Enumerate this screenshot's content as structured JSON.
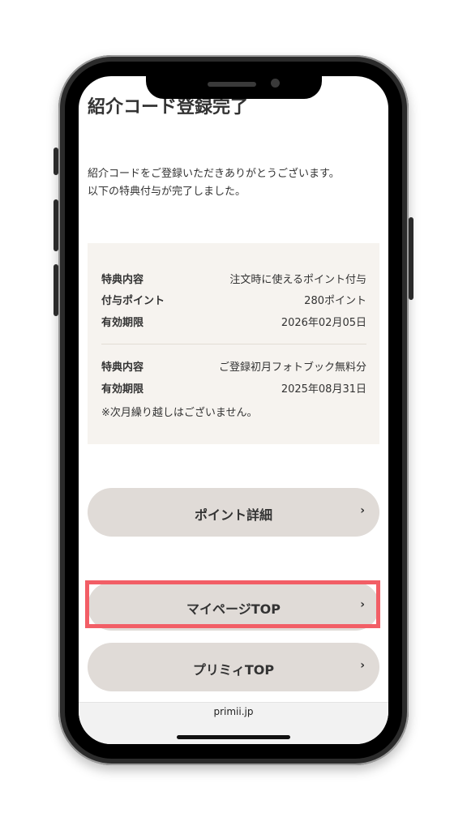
{
  "page": {
    "title": "紹介コード登録完了",
    "message_lines": [
      "紹介コードをご登録いただきありがとうございます。",
      "以下の特典付与が完了しました。"
    ]
  },
  "benefits": {
    "group1": {
      "content_label": "特典内容",
      "content_value": "注文時に使えるポイント付与",
      "points_label": "付与ポイント",
      "points_value": "280ポイント",
      "expiry_label": "有効期限",
      "expiry_value": "2026年02月05日"
    },
    "group2": {
      "content_label": "特典内容",
      "content_value": "ご登録初月フォトブック無料分",
      "expiry_label": "有効期限",
      "expiry_value": "2025年08月31日",
      "note": "※次月繰り越しはございません。"
    }
  },
  "buttons": {
    "point_detail": "ポイント詳細",
    "mypage_top": "マイページTOP",
    "primii_top": "プリミィTOP",
    "chevron": "›"
  },
  "browser": {
    "url": "primii.jp"
  },
  "colors": {
    "highlight": "#f25e66",
    "button_bg": "#e0dbd7",
    "box_bg": "#f6f3ef"
  }
}
